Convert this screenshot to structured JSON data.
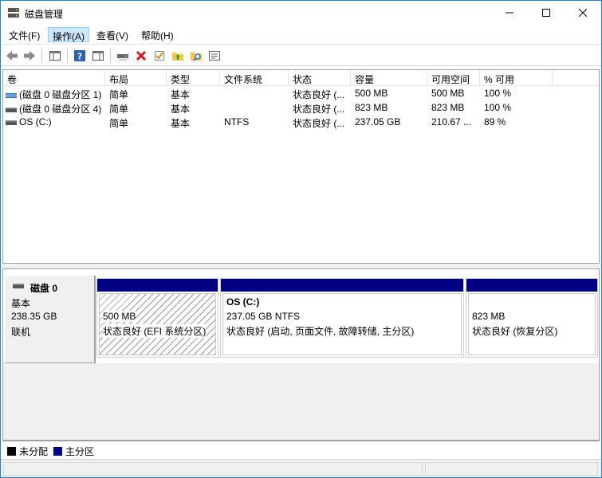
{
  "window": {
    "title": "磁盘管理"
  },
  "menu": [
    {
      "label": "文件(F)"
    },
    {
      "label": "操作(A)"
    },
    {
      "label": "查看(V)"
    },
    {
      "label": "帮助(H)"
    }
  ],
  "toolbar": {
    "icons": [
      "back-arrow-icon",
      "forward-arrow-icon",
      "console-tree-icon",
      "help-icon",
      "show-pane-icon",
      "connect-drive-icon",
      "delete-icon",
      "check-icon",
      "folder-up-icon",
      "folder-search-icon",
      "properties-icon"
    ]
  },
  "volume_table": {
    "columns": [
      "卷",
      "布局",
      "类型",
      "文件系统",
      "状态",
      "容量",
      "可用空间",
      "% 可用"
    ],
    "rows": [
      {
        "volume": "(磁盘 0 磁盘分区 1)",
        "layout": "简单",
        "type": "基本",
        "fs": "",
        "status": "状态良好 (...",
        "capacity": "500 MB",
        "free": "500 MB",
        "pct": "100 %",
        "icon": "striped-volume-icon"
      },
      {
        "volume": "(磁盘 0 磁盘分区 4)",
        "layout": "简单",
        "type": "基本",
        "fs": "",
        "status": "状态良好 (...",
        "capacity": "823 MB",
        "free": "823 MB",
        "pct": "100 %",
        "icon": "volume-icon"
      },
      {
        "volume": "OS (C:)",
        "layout": "简单",
        "type": "基本",
        "fs": "NTFS",
        "status": "状态良好 (...",
        "capacity": "237.05 GB",
        "free": "210.67 ...",
        "pct": "89 %",
        "icon": "volume-icon"
      }
    ]
  },
  "disk": {
    "name": "磁盘 0",
    "type": "基本",
    "size": "238.35 GB",
    "state": "联机",
    "partitions": [
      {
        "title": "",
        "size": "500 MB",
        "status": "状态良好 (EFI 系统分区)"
      },
      {
        "title": "OS  (C:)",
        "size": "237.05 GB NTFS",
        "status": "状态良好 (启动, 页面文件, 故障转储, 主分区)"
      },
      {
        "title": "",
        "size": "823 MB",
        "status": "状态良好 (恢复分区)"
      }
    ]
  },
  "legend": [
    {
      "label": "未分配",
      "color": "#000000"
    },
    {
      "label": "主分区",
      "color": "#000080"
    }
  ],
  "colors": {
    "primary_partition": "#000080",
    "menu_active": "#cce8ff",
    "window_border": "#1883d7"
  }
}
